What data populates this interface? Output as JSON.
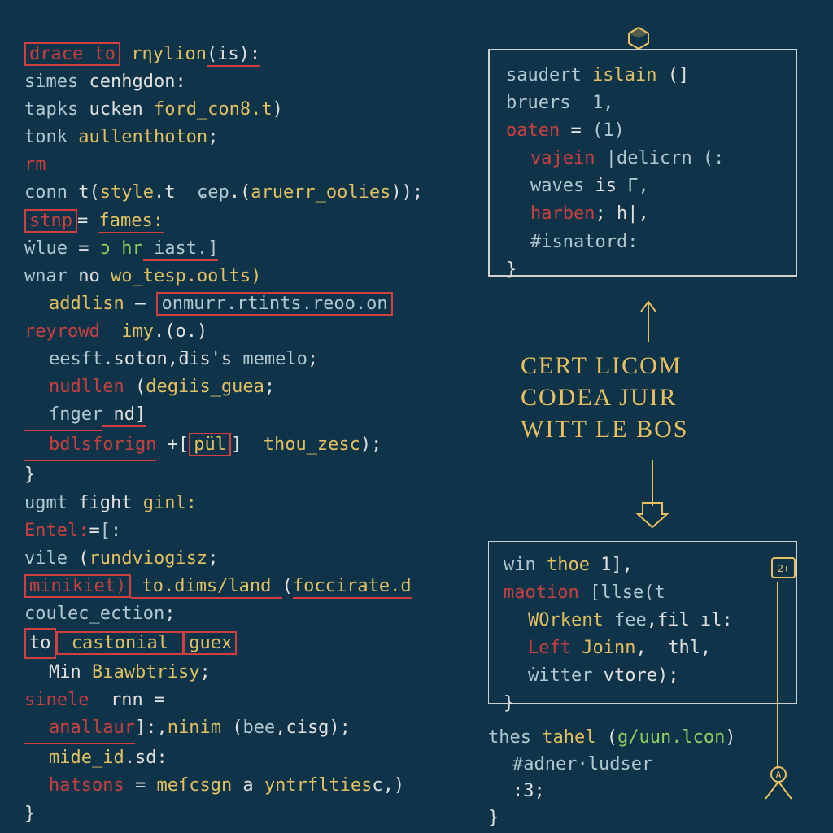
{
  "left": [
    [
      {
        "t": "drace to",
        "c": "kw",
        "hl": "red"
      },
      {
        "t": " ",
        "c": "txt"
      },
      {
        "t": "rηylion",
        "c": "fn"
      },
      {
        "t": "(is):",
        "c": "txt",
        "hl": "redline"
      }
    ],
    [
      {
        "t": "simes",
        "c": "dim"
      },
      {
        "t": " cenhgdon:",
        "c": "txt"
      }
    ],
    [
      {
        "t": "tapks",
        "c": "dim"
      },
      {
        "t": " ucken ",
        "c": "txt"
      },
      {
        "t": "ford_con8.t",
        "c": "fn"
      },
      {
        "t": ")",
        "c": "txt"
      }
    ],
    [
      {
        "t": "tonk ",
        "c": "dim"
      },
      {
        "t": "aullenthoton",
        "c": "fn"
      },
      {
        "t": ";",
        "c": "txt"
      }
    ],
    [
      {
        "t": "rm",
        "c": "kw"
      }
    ],
    [
      {
        "t": "conn",
        "c": "dim"
      },
      {
        "t": " t(",
        "c": "txt"
      },
      {
        "t": "style",
        "c": "fn"
      },
      {
        "t": ".t  ",
        "c": "txt"
      },
      {
        "t": "ɕep",
        "c": "dim"
      },
      {
        "t": ".(",
        "c": "txt"
      },
      {
        "t": "aruerr_oolies",
        "c": "fn"
      },
      {
        "t": "));",
        "c": "txt"
      }
    ],
    [
      {
        "t": "stnp",
        "c": "kw",
        "hl": "red"
      },
      {
        "t": "= ",
        "c": "txt"
      },
      {
        "t": "fames:",
        "c": "fn",
        "hl": "redline"
      }
    ],
    [
      {
        "t": "ẇlue",
        "c": "dim"
      },
      {
        "t": " = ",
        "c": "txt"
      },
      {
        "t": "ɔ hr",
        "c": "lit"
      },
      {
        "t": " iast.]",
        "c": "dim",
        "hl": "redline"
      }
    ],
    [
      {
        "t": "wnar ",
        "c": "dim"
      },
      {
        "t": "no",
        "c": "txt"
      },
      {
        "t": " wo_tesp.oolts)",
        "c": "fn"
      }
    ],
    [
      {
        "t": "addlisn",
        "c": "fn",
        "ind": 1
      },
      {
        "t": " – ",
        "c": "txt"
      },
      {
        "t": "onmurr.rtints.reoo.on",
        "c": "dim",
        "hl": "red"
      }
    ],
    [
      {
        "t": "reyrowd",
        "c": "kw"
      },
      {
        "t": "  imy",
        "c": "fn"
      },
      {
        "t": ".(o.)",
        "c": "txt"
      }
    ],
    [
      {
        "t": "eesft",
        "c": "dim",
        "ind": 1
      },
      {
        "t": ".soton,ƌis's ",
        "c": "txt"
      },
      {
        "t": "memelo",
        "c": "dim"
      },
      {
        "t": ";",
        "c": "txt"
      }
    ],
    [
      {
        "t": "nudllen",
        "c": "kw",
        "ind": 1
      },
      {
        "t": " (",
        "c": "txt"
      },
      {
        "t": "degiis_guea",
        "c": "fn"
      },
      {
        "t": ";",
        "c": "txt"
      }
    ],
    [
      {
        "t": "ſnger",
        "c": "dim",
        "ind": 1,
        "hl": "redline"
      },
      {
        "t": " nd]",
        "c": "txt",
        "hl": "redline"
      }
    ],
    [
      {
        "t": "bdlsforign",
        "c": "kw",
        "ind": 1,
        "hl": "redline"
      },
      {
        "t": " +[",
        "c": "txt"
      },
      {
        "t": "pül",
        "c": "fn",
        "hl": "red"
      },
      {
        "t": "]  ",
        "c": "txt"
      },
      {
        "t": "thou_zesc",
        "c": "fn"
      },
      {
        "t": ");",
        "c": "txt"
      }
    ],
    [
      {
        "t": "}",
        "c": "txt"
      }
    ],
    [
      {
        "t": "ugmt",
        "c": "dim"
      },
      {
        "t": " fight ",
        "c": "txt"
      },
      {
        "t": "ginl:",
        "c": "fn"
      }
    ],
    [
      {
        "t": "Entel:",
        "c": "kw"
      },
      {
        "t": "=",
        "c": "txt"
      },
      {
        "t": "[:",
        "c": "dim"
      }
    ],
    [
      {
        "t": "vile ",
        "c": "dim"
      },
      {
        "t": "(",
        "c": "txt"
      },
      {
        "t": "rundviogisz",
        "c": "fn"
      },
      {
        "t": ";",
        "c": "txt"
      }
    ],
    [
      {
        "t": "minikiet)",
        "c": "kw",
        "hl": "red"
      },
      {
        "t": " to.dims/land ",
        "c": "fn",
        "hl": "redline"
      },
      {
        "t": "(",
        "c": "txt"
      },
      {
        "t": "foccirate.d",
        "c": "fn",
        "hl": "redline"
      }
    ],
    [
      {
        "t": "coulec_ection",
        "c": "dim"
      },
      {
        "t": ";",
        "c": "txt"
      }
    ],
    [
      {
        "t": "to",
        "c": "txt",
        "ind": 1,
        "hl": "red"
      },
      {
        "t": " castonial ",
        "c": "fn",
        "hl": "red"
      },
      {
        "t": "guex",
        "c": "fn",
        "hl": "red"
      }
    ],
    [
      {
        "t": "Min ",
        "c": "txt",
        "ind": 1
      },
      {
        "t": "Bıawbtrisy",
        "c": "fn"
      },
      {
        "t": ";",
        "c": "txt"
      }
    ],
    [
      {
        "t": "sinele",
        "c": "kw"
      },
      {
        "t": "  rnn =",
        "c": "txt"
      }
    ],
    [
      {
        "t": "anallaur",
        "c": "kw",
        "ind": 1,
        "hl": "redline"
      },
      {
        "t": "]:,",
        "c": "txt"
      },
      {
        "t": "ninim",
        "c": "fn"
      },
      {
        "t": " (",
        "c": "txt"
      },
      {
        "t": "bee",
        "c": "dim"
      },
      {
        "t": ",cisg);",
        "c": "txt"
      }
    ],
    [
      {
        "t": "mide_id",
        "c": "fn",
        "ind": 1
      },
      {
        "t": ".sd:",
        "c": "txt"
      }
    ],
    [
      {
        "t": "hatsons",
        "c": "kw",
        "ind": 1
      },
      {
        "t": " = ",
        "c": "txt"
      },
      {
        "t": "meſcsgn",
        "c": "fn"
      },
      {
        "t": " a ",
        "c": "txt"
      },
      {
        "t": "yntrflties",
        "c": "fn"
      },
      {
        "t": "c,)",
        "c": "txt"
      }
    ],
    [
      {
        "t": "}",
        "c": "txt"
      }
    ]
  ],
  "box1": [
    [
      {
        "t": "saudert",
        "c": "dim"
      },
      {
        "t": " islain ",
        "c": "fn"
      },
      {
        "t": "(]",
        "c": "txt"
      }
    ],
    [
      {
        "t": "bruers  1,",
        "c": "dim"
      }
    ],
    [
      {
        "t": "oaten",
        "c": "kw"
      },
      {
        "t": " = ",
        "c": "txt"
      },
      {
        "t": "(1)",
        "c": "dim"
      }
    ],
    [
      {
        "t": "vajein",
        "c": "kw",
        "ind": 1
      },
      {
        "t": " |delicrn (:",
        "c": "dim"
      }
    ],
    [
      {
        "t": "waves",
        "c": "dim",
        "ind": 1
      },
      {
        "t": " is ",
        "c": "txt"
      },
      {
        "t": "Γ,",
        "c": "dim"
      }
    ],
    [
      {
        "t": "harben",
        "c": "kw",
        "ind": 1
      },
      {
        "t": "; h|,",
        "c": "txt"
      }
    ],
    [
      {
        "t": "#isnatord:",
        "c": "dim",
        "ind": 1
      }
    ],
    [
      {
        "t": "}",
        "c": "txt"
      }
    ]
  ],
  "headline": {
    "l1": "CERT LICOM",
    "l2": "CODEA JUIR",
    "l3": "WITT LE BOS"
  },
  "box2": [
    [
      {
        "t": "win ",
        "c": "dim"
      },
      {
        "t": "thoe",
        "c": "fn"
      },
      {
        "t": " 1],",
        "c": "txt"
      }
    ],
    [
      {
        "t": "maotion",
        "c": "kw"
      },
      {
        "t": " [llse(t",
        "c": "dim"
      }
    ],
    [
      {
        "t": "WOrkent",
        "c": "fn",
        "ind": 1
      },
      {
        "t": " fee",
        "c": "dim"
      },
      {
        "t": ",fil ıl:",
        "c": "txt"
      }
    ],
    [
      {
        "t": "Left",
        "c": "kw",
        "ind": 1
      },
      {
        "t": " Joinn",
        "c": "fn"
      },
      {
        "t": ",  thl,",
        "c": "txt"
      }
    ],
    [
      {
        "t": "ẇitter",
        "c": "dim",
        "ind": 1
      },
      {
        "t": " vtore);",
        "c": "txt"
      }
    ],
    [
      {
        "t": "}",
        "c": "txt"
      }
    ]
  ],
  "snippet": [
    [
      {
        "t": "thes ",
        "c": "dim"
      },
      {
        "t": "tahel",
        "c": "fn"
      },
      {
        "t": " (",
        "c": "txt"
      },
      {
        "t": "g/uun.lcon",
        "c": "lit"
      },
      {
        "t": ")",
        "c": "txt"
      }
    ],
    [
      {
        "t": "#adner·ludser",
        "c": "dim",
        "ind": 1
      }
    ],
    [
      {
        "t": ":3;",
        "c": "txt",
        "ind": 1
      }
    ],
    [
      {
        "t": "}",
        "c": "txt"
      }
    ]
  ]
}
